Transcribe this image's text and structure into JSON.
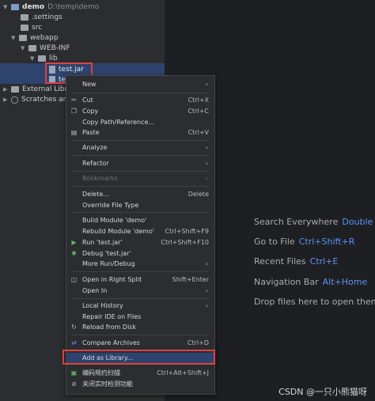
{
  "tree": {
    "project_name": "demo",
    "project_path": "D:\\temp\\demo",
    "items": [
      {
        "label": ".settings"
      },
      {
        "label": "src"
      },
      {
        "label": "webapp"
      },
      {
        "label": "WEB-INF"
      },
      {
        "label": "lib"
      },
      {
        "label": "test.jar"
      },
      {
        "label": "te"
      },
      {
        "label": "External Librar"
      },
      {
        "label": "Scratches and"
      }
    ]
  },
  "menu": {
    "items": [
      {
        "label": "New",
        "shortcut": "",
        "submenu": true
      },
      {
        "label": "Cut",
        "shortcut": "Ctrl+X"
      },
      {
        "label": "Copy",
        "shortcut": "Ctrl+C"
      },
      {
        "label": "Copy Path/Reference...",
        "shortcut": ""
      },
      {
        "label": "Paste",
        "shortcut": "Ctrl+V"
      },
      {
        "label": "Analyze",
        "shortcut": "",
        "submenu": true
      },
      {
        "label": "Refactor",
        "shortcut": "",
        "submenu": true
      },
      {
        "label": "Bookmarks",
        "shortcut": "",
        "submenu": true
      },
      {
        "label": "Delete...",
        "shortcut": "Delete"
      },
      {
        "label": "Override File Type",
        "shortcut": ""
      },
      {
        "label": "Build Module 'demo'",
        "shortcut": ""
      },
      {
        "label": "Rebuild Module 'demo'",
        "shortcut": "Ctrl+Shift+F9"
      },
      {
        "label": "Run 'test.jar'",
        "shortcut": "Ctrl+Shift+F10"
      },
      {
        "label": "Debug 'test.jar'",
        "shortcut": ""
      },
      {
        "label": "More Run/Debug",
        "shortcut": "",
        "submenu": true
      },
      {
        "label": "Open in Right Split",
        "shortcut": "Shift+Enter"
      },
      {
        "label": "Open In",
        "shortcut": "",
        "submenu": true
      },
      {
        "label": "Local History",
        "shortcut": "",
        "submenu": true
      },
      {
        "label": "Repair IDE on Files",
        "shortcut": ""
      },
      {
        "label": "Reload from Disk",
        "shortcut": ""
      },
      {
        "label": "Compare Archives",
        "shortcut": "Ctrl+D"
      },
      {
        "label": "Add as Library...",
        "shortcut": ""
      },
      {
        "label": "编码规约扫描",
        "shortcut": "Ctrl+Alt+Shift+J"
      },
      {
        "label": "关闭实时检测功能",
        "shortcut": ""
      }
    ]
  },
  "hints": [
    {
      "label": "Search Everywhere",
      "key": "Double Sh"
    },
    {
      "label": "Go to File",
      "key": "Ctrl+Shift+R"
    },
    {
      "label": "Recent Files",
      "key": "Ctrl+E"
    },
    {
      "label": "Navigation Bar",
      "key": "Alt+Home"
    },
    {
      "label": "Drop files here to open them",
      "key": ""
    }
  ],
  "watermark": "CSDN @一只小熊猫呀",
  "colors": {
    "accent": "#5a93f6",
    "highlight_border": "#e04040",
    "selection": "#2e436e"
  }
}
